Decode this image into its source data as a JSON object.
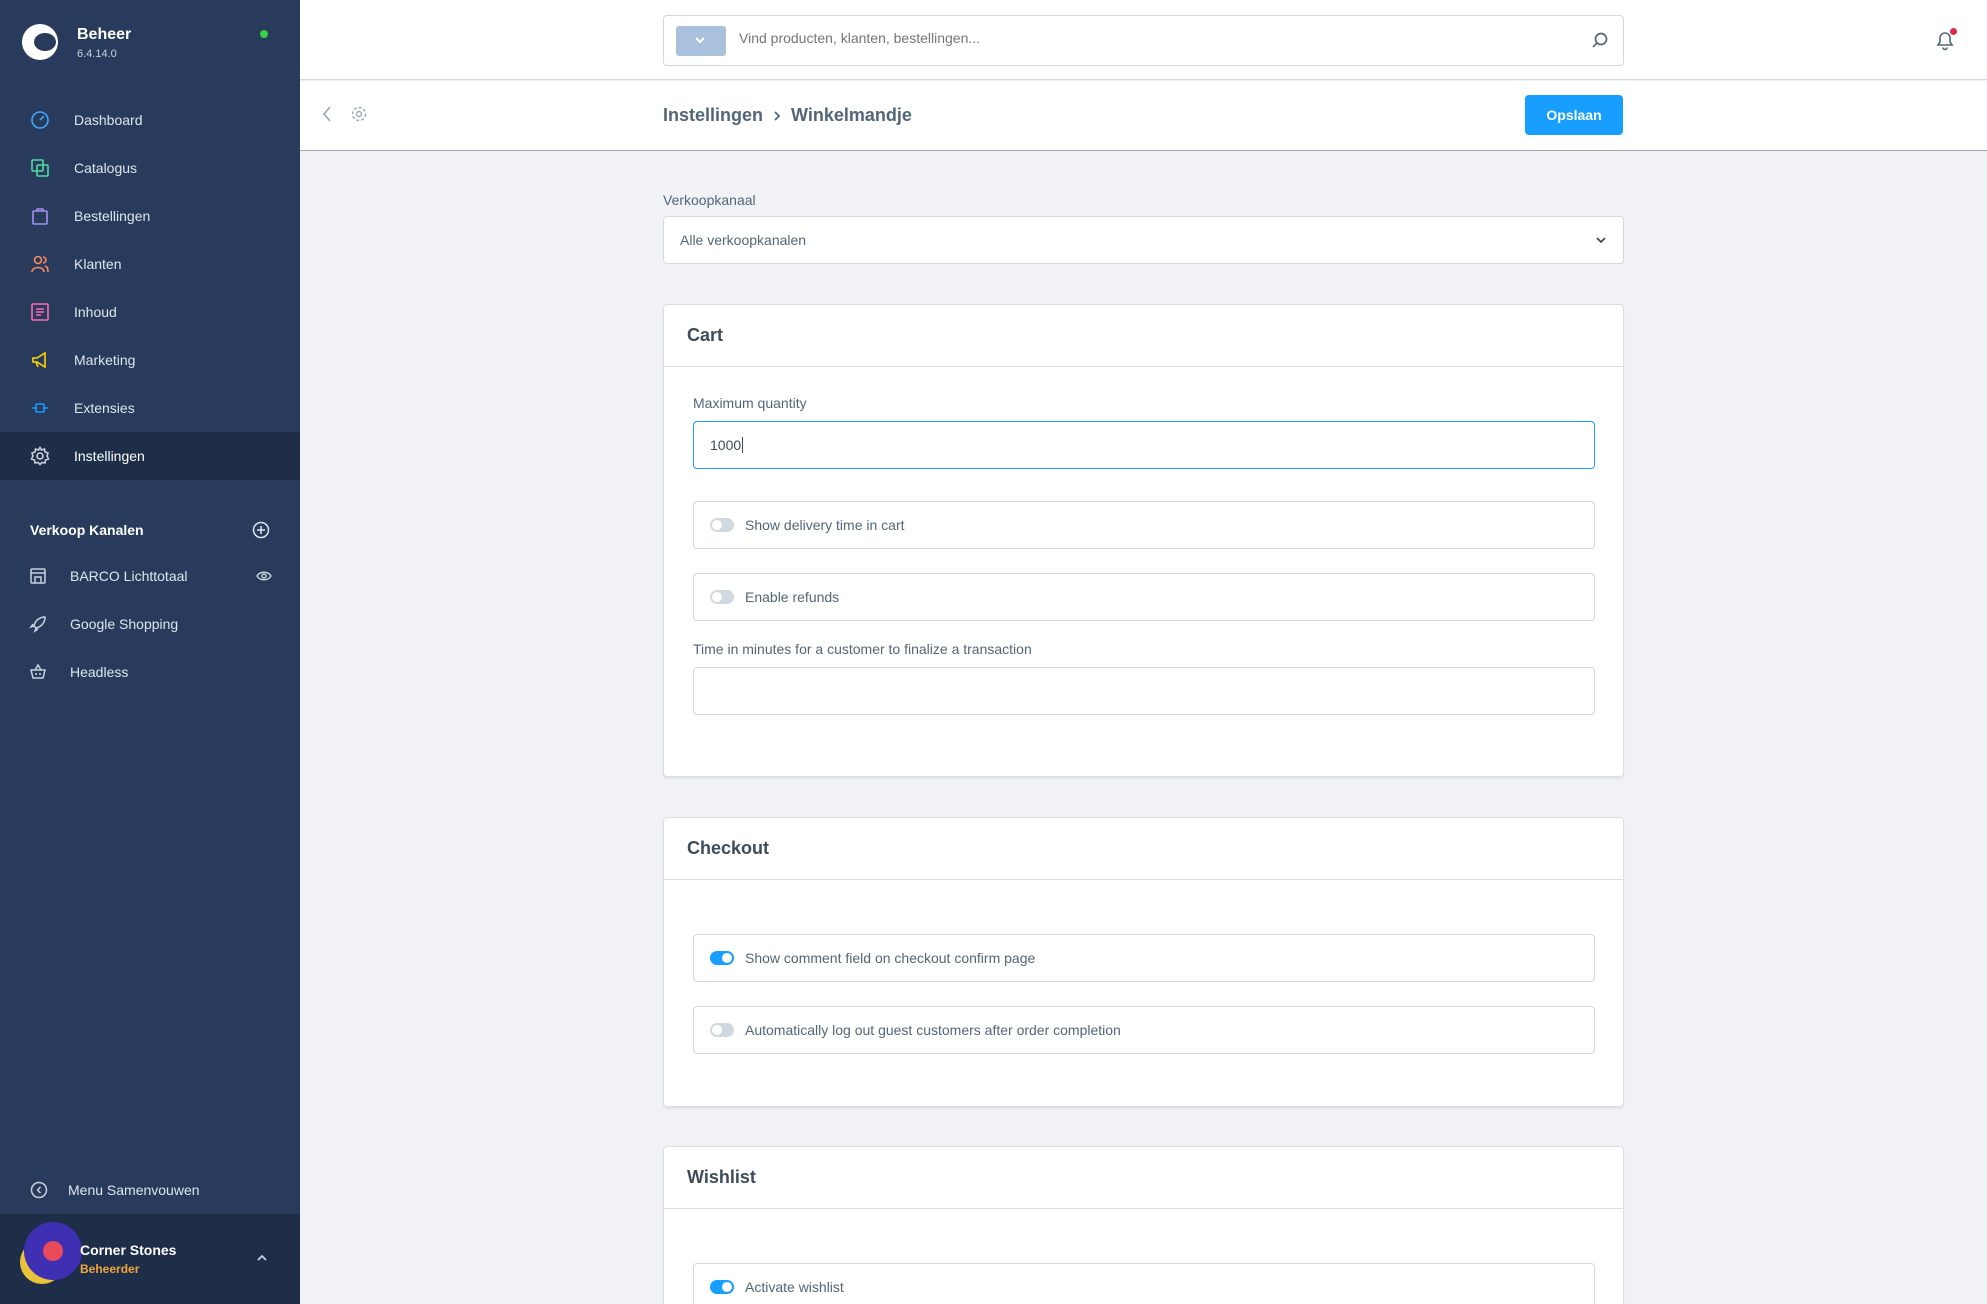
{
  "brand": {
    "title": "Beheer",
    "version": "6.4.14.0"
  },
  "nav": [
    {
      "label": "Dashboard",
      "icon": "dashboard-icon"
    },
    {
      "label": "Catalogus",
      "icon": "catalog-icon"
    },
    {
      "label": "Bestellingen",
      "icon": "orders-icon"
    },
    {
      "label": "Klanten",
      "icon": "customers-icon"
    },
    {
      "label": "Inhoud",
      "icon": "content-icon"
    },
    {
      "label": "Marketing",
      "icon": "megaphone-icon"
    },
    {
      "label": "Extensies",
      "icon": "plug-icon"
    },
    {
      "label": "Instellingen",
      "icon": "gear-icon",
      "active": true
    }
  ],
  "sales_channels": {
    "title": "Verkoop Kanalen",
    "items": [
      {
        "label": "BARCO Lichttotaal",
        "icon": "storefront-icon"
      },
      {
        "label": "Google Shopping",
        "icon": "rocket-icon"
      },
      {
        "label": "Headless",
        "icon": "basket-icon"
      }
    ]
  },
  "sidebar_footer": {
    "collapse_label": "Menu Samenvouwen"
  },
  "user": {
    "name": "Corner Stones",
    "role": "Beheerder"
  },
  "search": {
    "placeholder": "Vind producten, klanten, bestellingen..."
  },
  "breadcrumb": {
    "parent": "Instellingen",
    "current": "Winkelmandje"
  },
  "actions": {
    "save": "Opslaan"
  },
  "sales_channel_select": {
    "label": "Verkoopkanaal",
    "value": "Alle verkoopkanalen"
  },
  "cart": {
    "title": "Cart",
    "max_quantity_label": "Maximum quantity",
    "max_quantity_value": "1000",
    "show_delivery_time": {
      "label": "Show delivery time in cart",
      "checked": false
    },
    "enable_refunds": {
      "label": "Enable refunds",
      "checked": false
    },
    "finalize_time_label": "Time in minutes for a customer to finalize a transaction",
    "finalize_time_value": ""
  },
  "checkout": {
    "title": "Checkout",
    "show_comment": {
      "label": "Show comment field on checkout confirm page",
      "checked": true
    },
    "auto_logout": {
      "label": "Automatically log out guest customers after order completion",
      "checked": false
    }
  },
  "wishlist": {
    "title": "Wishlist",
    "activate": {
      "label": "Activate wishlist",
      "checked": true
    }
  },
  "colors": {
    "sidebar": "#283b5c",
    "accent": "#189eff",
    "online": "#37d046",
    "role": "#f0a63a"
  }
}
